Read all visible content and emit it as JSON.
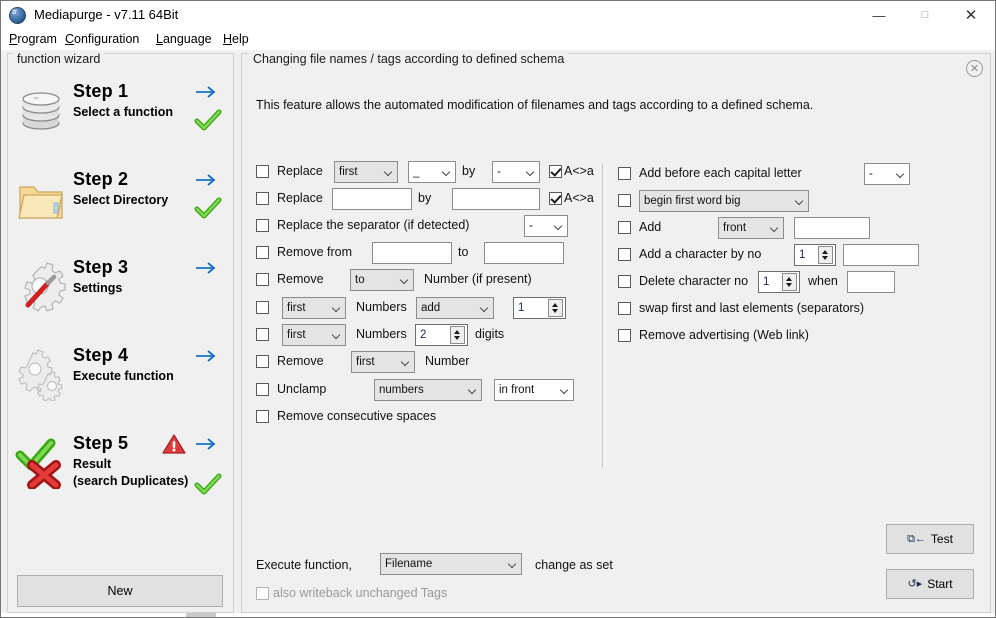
{
  "window": {
    "title": "Mediapurge - v7.11 64Bit",
    "app_icon": "app-logo-icon",
    "minimize": "—",
    "maximize": "□",
    "close": "✕"
  },
  "menubar": {
    "items": [
      {
        "label": "Program",
        "mnemonic": "P"
      },
      {
        "label": "Configuration",
        "mnemonic": "C"
      },
      {
        "label": "Language",
        "mnemonic": "L"
      },
      {
        "label": "Help",
        "mnemonic": "H"
      }
    ]
  },
  "wizard": {
    "legend": "function wizard",
    "new_button": "New",
    "steps": [
      {
        "title": "Step 1",
        "subtitle": "Select a function",
        "subtitle2": "",
        "icon": "database-stack-icon",
        "arrow": true,
        "check": true,
        "warning": false
      },
      {
        "title": "Step 2",
        "subtitle": "Select Directory",
        "subtitle2": "",
        "icon": "folder-icon",
        "arrow": true,
        "check": true,
        "warning": false
      },
      {
        "title": "Step 3",
        "subtitle": "Settings",
        "subtitle2": "",
        "icon": "gear-screwdriver-icon",
        "arrow": true,
        "check": false,
        "warning": false
      },
      {
        "title": "Step 4",
        "subtitle": "Execute function",
        "subtitle2": "",
        "icon": "gears-icon",
        "arrow": true,
        "check": false,
        "warning": false
      },
      {
        "title": "Step 5",
        "subtitle": "Result",
        "subtitle2": "(search Duplicates)",
        "icon": "check-cross-icon",
        "arrow": true,
        "check": true,
        "warning": true
      }
    ]
  },
  "panel": {
    "legend": "Changing file names / tags according to defined schema",
    "close_icon": "✕",
    "intro": "This feature allows the automated modification of filenames and tags according to a defined schema."
  },
  "left_column": {
    "row1": {
      "checked": false,
      "label": "Replace",
      "scope_value": "first",
      "what_value": "_",
      "by_label": "by",
      "with_value": "-",
      "case_checked": true,
      "case_label": "A<>a"
    },
    "row2": {
      "checked": false,
      "label": "Replace",
      "find_value": "",
      "by_label": "by",
      "replace_value": "",
      "case_checked": true,
      "case_label": "A<>a"
    },
    "row3": {
      "checked": false,
      "label": "Replace the separator (if detected)",
      "separator_value": "-"
    },
    "row4": {
      "checked": false,
      "label": "Remove from",
      "from_value": "",
      "to_label": "to",
      "to_value": ""
    },
    "row5": {
      "checked": false,
      "label": "Remove",
      "mode_value": "to",
      "suffix": "Number (if present)"
    },
    "row6": {
      "checked": false,
      "scope_value": "first",
      "numbers_label": "Numbers",
      "action_value": "add",
      "count_value": "1"
    },
    "row7": {
      "checked": false,
      "scope_value": "first",
      "numbers_label": "Numbers",
      "digits_value": "2",
      "digits_label": "digits"
    },
    "row8": {
      "checked": false,
      "label": "Remove",
      "scope_value": "first",
      "suffix": "Number"
    },
    "row9": {
      "checked": false,
      "label": "Unclamp",
      "what_value": "numbers",
      "where_value": "in front"
    },
    "row10": {
      "checked": false,
      "label": "Remove consecutive spaces"
    }
  },
  "right_column": {
    "row1": {
      "checked": false,
      "label": "Add before each capital letter",
      "char_value": "-"
    },
    "row2": {
      "checked": false,
      "mode_value": "begin first word big"
    },
    "row3": {
      "checked": false,
      "label": "Add",
      "position_value": "front",
      "text_value": ""
    },
    "row4": {
      "checked": false,
      "label": "Add a character by no",
      "no_value": "1",
      "text_value": ""
    },
    "row5": {
      "checked": false,
      "label": "Delete character no",
      "no_value": "1",
      "when_label": "when",
      "when_value": ""
    },
    "row6": {
      "checked": false,
      "label": "swap first and last elements (separators)"
    },
    "row7": {
      "checked": false,
      "label": "Remove advertising (Web link)"
    }
  },
  "footer": {
    "execute_label": "Execute function,",
    "target_value": "Filename",
    "suffix_label": "change as set",
    "writeback_checked": false,
    "writeback_label": "also writeback unchanged Tags",
    "test_button": "Test",
    "test_icon": "⧉←",
    "start_button": "Start",
    "start_icon": "↺▸"
  },
  "colors": {
    "window_bg": "#f0f0f0",
    "titlebar_bg": "#ffffff",
    "accent_arrow": "#1a6fc4",
    "check_green": "#4fbe26",
    "warn_red": "#d83030",
    "button_face": "#e1e1e1",
    "combo_face": "#e4e4e4",
    "field_bg": "#ffffff",
    "border": "#8c8c8c"
  }
}
